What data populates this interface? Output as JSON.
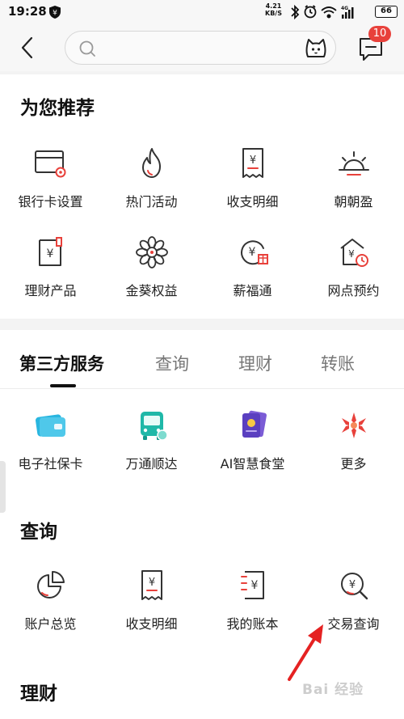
{
  "status_bar": {
    "time": "19:28",
    "net_speed_value": "4.21",
    "net_speed_unit": "KB/S",
    "network": "4G",
    "battery": "66"
  },
  "header": {
    "search_placeholder": "",
    "message_badge": "10"
  },
  "recommend": {
    "title": "为您推荐",
    "items": [
      {
        "label": "银行卡设置",
        "icon": "bank-card-settings-icon"
      },
      {
        "label": "热门活动",
        "icon": "flame-icon"
      },
      {
        "label": "收支明细",
        "icon": "receipt-icon"
      },
      {
        "label": "朝朝盈",
        "icon": "sunrise-icon"
      },
      {
        "label": "理财产品",
        "icon": "finance-product-icon"
      },
      {
        "label": "金葵权益",
        "icon": "sunflower-icon"
      },
      {
        "label": "薪福通",
        "icon": "salary-coin-icon"
      },
      {
        "label": "网点预约",
        "icon": "branch-appointment-icon"
      }
    ]
  },
  "tabs": {
    "items": [
      "第三方服务",
      "查询",
      "理财",
      "转账"
    ],
    "active": "第三方服务"
  },
  "third_party": {
    "items": [
      {
        "label": "电子社保卡",
        "icon": "social-security-card-icon"
      },
      {
        "label": "万通顺达",
        "icon": "bus-icon"
      },
      {
        "label": "AI智慧食堂",
        "icon": "ai-canteen-icon"
      },
      {
        "label": "更多",
        "icon": "more-flower-icon"
      }
    ]
  },
  "query": {
    "title": "查询",
    "items": [
      {
        "label": "账户总览",
        "icon": "pie-chart-icon"
      },
      {
        "label": "收支明细",
        "icon": "receipt-icon"
      },
      {
        "label": "我的账本",
        "icon": "ledger-icon"
      },
      {
        "label": "交易查询",
        "icon": "search-yen-icon"
      }
    ]
  },
  "finance": {
    "title": "理财"
  },
  "watermark": "Bai 经验",
  "colors": {
    "accent_red": "#e8413b",
    "icon_stroke": "#333333",
    "tab_inactive": "#777777"
  }
}
